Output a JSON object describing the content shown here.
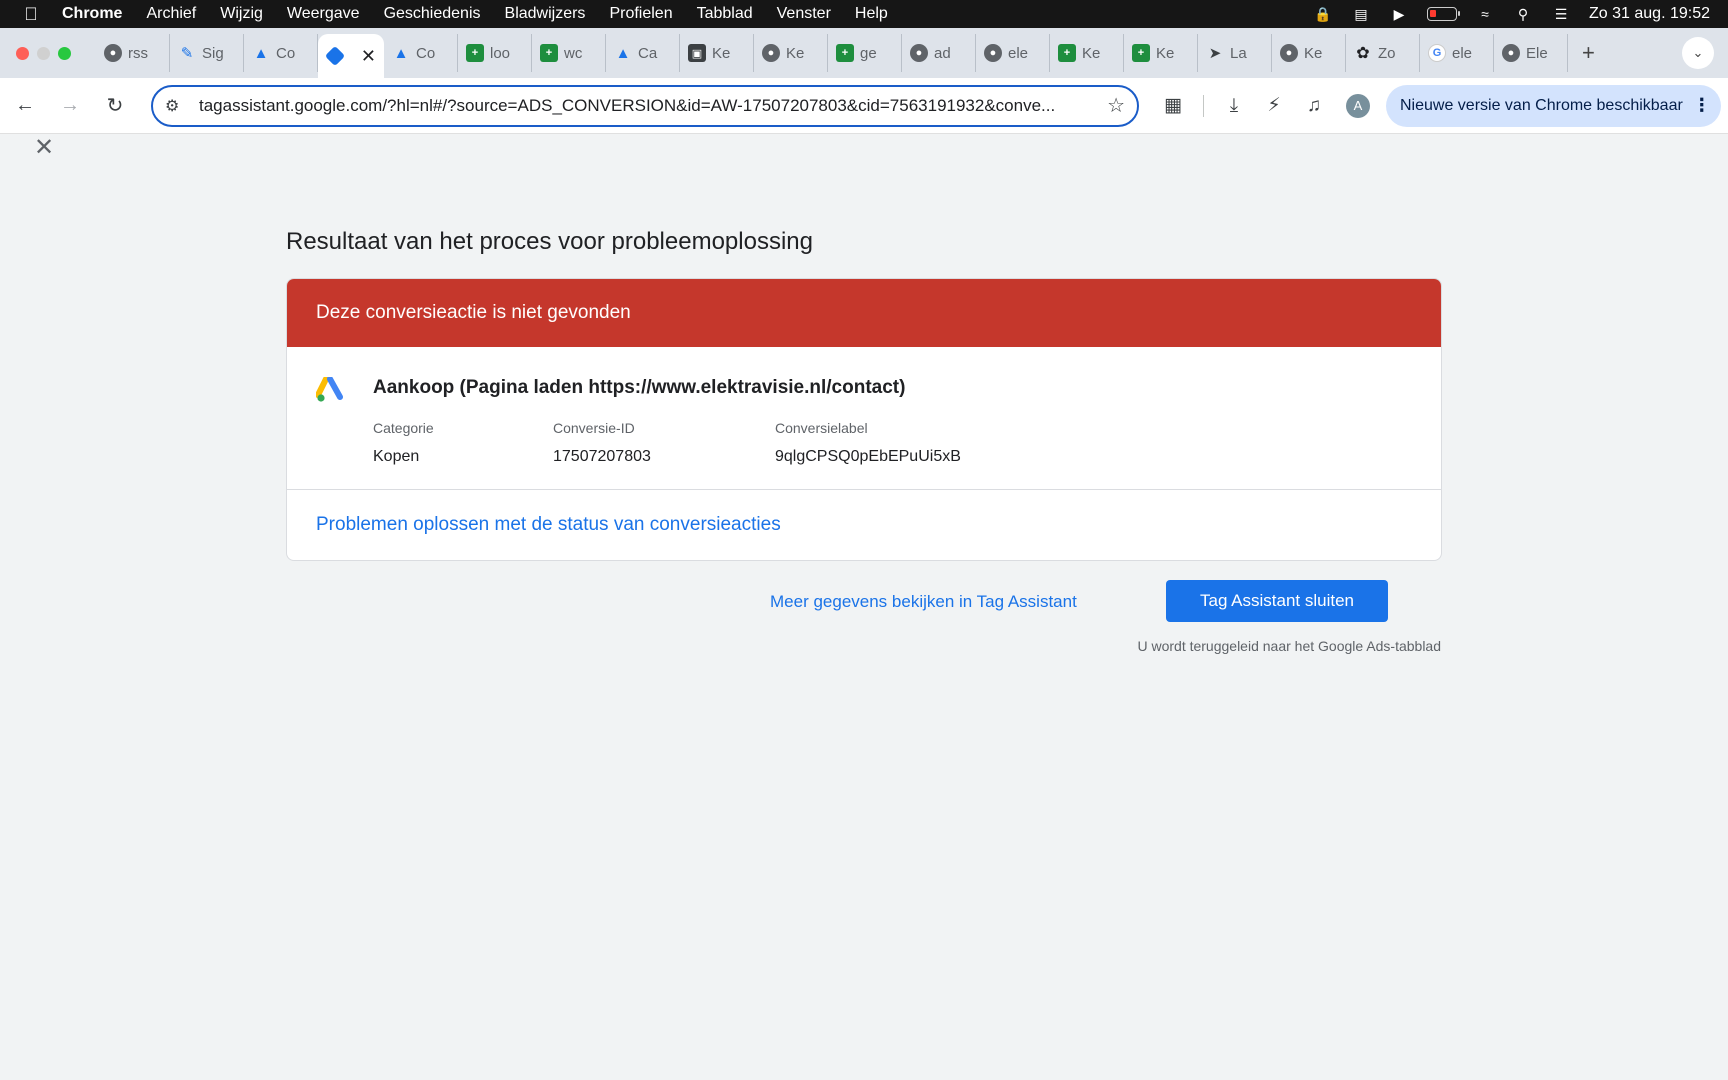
{
  "menubar": {
    "app": "Chrome",
    "items": [
      "Archief",
      "Wijzig",
      "Weergave",
      "Geschiedenis",
      "Bladwijzers",
      "Profielen",
      "Tabblad",
      "Venster",
      "Help"
    ],
    "clock": "Zo 31 aug.  19:52"
  },
  "tabs": [
    {
      "label": "rss",
      "icon": "globe-icon"
    },
    {
      "label": "Sig",
      "icon": "sig-icon"
    },
    {
      "label": "Co",
      "icon": "google-ads-icon"
    },
    {
      "label": "",
      "icon": "tag-assistant-icon",
      "active": true
    },
    {
      "label": "Co",
      "icon": "google-ads-icon"
    },
    {
      "label": "loo",
      "icon": "sheets-icon"
    },
    {
      "label": "wc",
      "icon": "sheets-icon"
    },
    {
      "label": "Ca",
      "icon": "google-ads-icon"
    },
    {
      "label": "Ke",
      "icon": "image-icon"
    },
    {
      "label": "Ke",
      "icon": "globe-icon"
    },
    {
      "label": "ge",
      "icon": "sheets-icon"
    },
    {
      "label": "ad",
      "icon": "globe-icon"
    },
    {
      "label": "ele",
      "icon": "globe-icon"
    },
    {
      "label": "Ke",
      "icon": "sheets-icon"
    },
    {
      "label": "Ke",
      "icon": "sheets-icon"
    },
    {
      "label": "La",
      "icon": "plane-icon"
    },
    {
      "label": "Ke",
      "icon": "globe-icon"
    },
    {
      "label": "Zo",
      "icon": "openai-icon"
    },
    {
      "label": "ele",
      "icon": "google-icon"
    },
    {
      "label": "Ele",
      "icon": "globe-icon"
    }
  ],
  "toolbar": {
    "url": "tagassistant.google.com/?hl=nl#/?source=ADS_CONVERSION&id=AW-17507207803&cid=7563191932&conve...",
    "avatar": "A",
    "update": "Nieuwe versie van Chrome beschikbaar"
  },
  "page": {
    "title": "Resultaat van het proces voor probleemoplossing",
    "error": "Deze conversieactie is niet gevonden",
    "conversion_name": "Aankoop (Pagina laden https://www.elektravisie.nl/contact)",
    "fields": {
      "category_label": "Categorie",
      "category_value": "Kopen",
      "id_label": "Conversie-ID",
      "id_value": "17507207803",
      "label_label": "Conversielabel",
      "label_value": "9qlgCPSQ0pEbEPuUi5xB"
    },
    "troubleshoot_link": "Problemen oplossen met de status van conversieacties",
    "more_link": "Meer gegevens bekijken in Tag Assistant",
    "close_button": "Tag Assistant sluiten",
    "redirect_note": "U wordt teruggeleid naar het Google Ads-tabblad"
  }
}
